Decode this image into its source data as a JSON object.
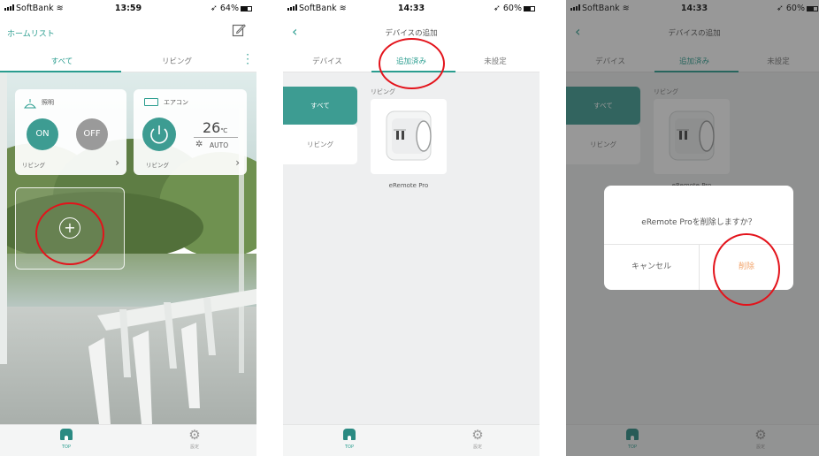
{
  "colors": {
    "accent": "#2a9d8f",
    "teal_dark": "#318f86",
    "red_marker": "#e3131b",
    "delete_orange": "#f2a46b"
  },
  "screen1": {
    "status": {
      "carrier": "SoftBank",
      "time": "13:59",
      "battery": "64%"
    },
    "title": "ホームリスト",
    "tabs": [
      "すべて",
      "リビング"
    ],
    "light_card": {
      "name": "照明",
      "on": "ON",
      "off": "OFF",
      "room": "リビング"
    },
    "ac_card": {
      "name": "エアコン",
      "temp": "26",
      "unit": "℃",
      "mode": "AUTO",
      "room": "リビング"
    },
    "tabbar": {
      "top": "TOP",
      "settings": "設定"
    }
  },
  "screen2": {
    "status": {
      "carrier": "SoftBank",
      "time": "14:33",
      "battery": "60%"
    },
    "title": "デバイスの追加",
    "tabs": [
      "デバイス",
      "追加済み",
      "未設定"
    ],
    "rooms": [
      "すべて",
      "リビング"
    ],
    "section_label": "リビング",
    "device_name": "eRemote Pro",
    "tabbar": {
      "top": "TOP",
      "settings": "設定"
    }
  },
  "screen3": {
    "status": {
      "carrier": "SoftBank",
      "time": "14:33",
      "battery": "60%"
    },
    "title": "デバイスの追加",
    "tabs": [
      "デバイス",
      "追加済み",
      "未設定"
    ],
    "rooms": [
      "すべて",
      "リビング"
    ],
    "section_label": "リビング",
    "device_name": "eRemote Pro",
    "dialog": {
      "message": "eRemote Proを削除しますか？",
      "cancel": "キャンセル",
      "delete": "削除"
    },
    "tabbar": {
      "top": "TOP",
      "settings": "設定"
    }
  }
}
